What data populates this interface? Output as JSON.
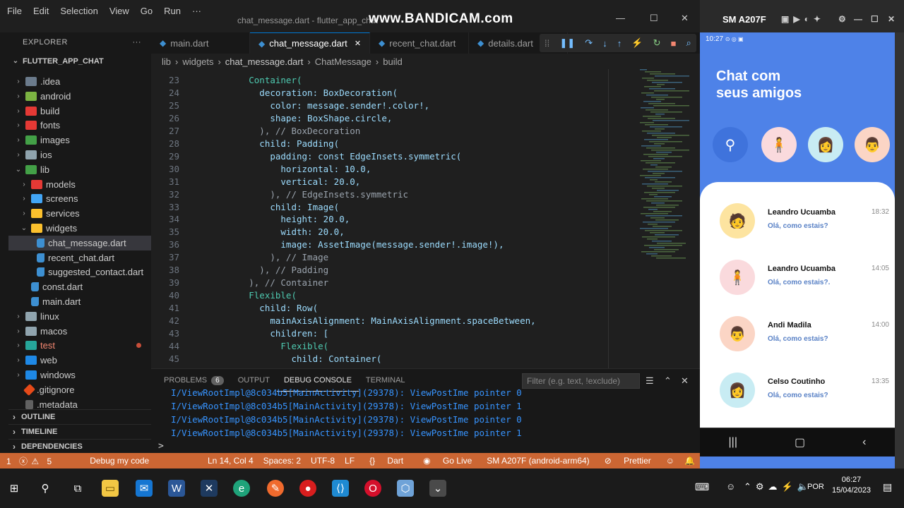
{
  "titlebar": {
    "menus": [
      "File",
      "Edit",
      "Selection",
      "View",
      "Go",
      "Run",
      "···"
    ],
    "title": "chat_message.dart - flutter_app_chat",
    "watermark": "www.BANDICAM.com"
  },
  "explorer": {
    "header": "EXPLORER",
    "more": "···",
    "project": "FLUTTER_APP_CHAT",
    "items": [
      {
        "label": ".idea",
        "indent": 1,
        "folder": true
      },
      {
        "label": "android",
        "indent": 1,
        "folder": true
      },
      {
        "label": "build",
        "indent": 1,
        "folder": true
      },
      {
        "label": "fonts",
        "indent": 1,
        "folder": true
      },
      {
        "label": "images",
        "indent": 1,
        "folder": true
      },
      {
        "label": "ios",
        "indent": 1,
        "folder": true
      },
      {
        "label": "lib",
        "indent": 1,
        "folder": true,
        "open": true
      },
      {
        "label": "models",
        "indent": 2,
        "folder": true
      },
      {
        "label": "screens",
        "indent": 2,
        "folder": true
      },
      {
        "label": "services",
        "indent": 2,
        "folder": true
      },
      {
        "label": "widgets",
        "indent": 2,
        "folder": true,
        "open": true
      },
      {
        "label": "chat_message.dart",
        "indent": 3,
        "folder": false,
        "selected": true
      },
      {
        "label": "recent_chat.dart",
        "indent": 3,
        "folder": false
      },
      {
        "label": "suggested_contact.dart",
        "indent": 3,
        "folder": false
      },
      {
        "label": "const.dart",
        "indent": 2,
        "folder": false
      },
      {
        "label": "main.dart",
        "indent": 2,
        "folder": false
      },
      {
        "label": "linux",
        "indent": 1,
        "folder": true
      },
      {
        "label": "macos",
        "indent": 1,
        "folder": true
      },
      {
        "label": "test",
        "indent": 1,
        "folder": true,
        "error": true
      },
      {
        "label": "web",
        "indent": 1,
        "folder": true
      },
      {
        "label": "windows",
        "indent": 1,
        "folder": true
      },
      {
        "label": ".gitignore",
        "indent": 1,
        "folder": false
      },
      {
        "label": ".metadata",
        "indent": 1,
        "folder": false
      }
    ],
    "sections": [
      "OUTLINE",
      "TIMELINE",
      "DEPENDENCIES"
    ]
  },
  "tabs": [
    "main.dart",
    "chat_message.dart",
    "recent_chat.dart",
    "details.dart"
  ],
  "active_tab": 1,
  "breadcrumb": [
    "lib",
    "widgets",
    "chat_message.dart",
    "ChatMessage",
    "build"
  ],
  "code": [
    {
      "n": "23",
      "t": "          Container("
    },
    {
      "n": "24",
      "t": "            decoration: BoxDecoration("
    },
    {
      "n": "25",
      "t": "              color: message.sender!.color!,"
    },
    {
      "n": "26",
      "t": "              shape: BoxShape.circle,"
    },
    {
      "n": "27",
      "t": "            ), // BoxDecoration"
    },
    {
      "n": "28",
      "t": "            child: Padding("
    },
    {
      "n": "29",
      "t": "              padding: const EdgeInsets.symmetric("
    },
    {
      "n": "30",
      "t": "                horizontal: 10.0,"
    },
    {
      "n": "31",
      "t": "                vertical: 20.0,"
    },
    {
      "n": "32",
      "t": "              ), // EdgeInsets.symmetric"
    },
    {
      "n": "33",
      "t": "              child: Image("
    },
    {
      "n": "34",
      "t": "                height: 20.0,"
    },
    {
      "n": "35",
      "t": "                width: 20.0,"
    },
    {
      "n": "36",
      "t": "                image: AssetImage(message.sender!.image!),"
    },
    {
      "n": "37",
      "t": "              ), // Image"
    },
    {
      "n": "38",
      "t": "            ), // Padding"
    },
    {
      "n": "39",
      "t": "          ), // Container"
    },
    {
      "n": "40",
      "t": "          Flexible("
    },
    {
      "n": "41",
      "t": "            child: Row("
    },
    {
      "n": "42",
      "t": "              mainAxisAlignment: MainAxisAlignment.spaceBetween,"
    },
    {
      "n": "43",
      "t": "              children: ["
    },
    {
      "n": "44",
      "t": "                Flexible("
    },
    {
      "n": "45",
      "t": "                  child: Container("
    }
  ],
  "panel": {
    "tabs": [
      "PROBLEMS",
      "OUTPUT",
      "DEBUG CONSOLE",
      "TERMINAL"
    ],
    "problems_count": "6",
    "active": 2,
    "filter_placeholder": "Filter (e.g. text, !exclude)",
    "log": [
      "I/ViewRootImpl@8c034b5[MainActivity](29378): ViewPostIme pointer 0",
      "I/ViewRootImpl@8c034b5[MainActivity](29378): ViewPostIme pointer 1",
      "I/ViewRootImpl@8c034b5[MainActivity](29378): ViewPostIme pointer 0",
      "I/ViewRootImpl@8c034b5[MainActivity](29378): ViewPostIme pointer 1"
    ],
    "prompt": ">"
  },
  "statusbar": {
    "errors": "1",
    "warnings": "5",
    "debug": "Debug my code",
    "position": "Ln 14, Col 4",
    "spaces": "Spaces: 2",
    "encoding": "UTF-8",
    "eol": "LF",
    "language": "Dart",
    "golive": "Go Live",
    "device": "SM A207F (android-arm64)",
    "prettier": "Prettier",
    "color": "#cc6633"
  },
  "phone": {
    "device_title": "SM A207F",
    "time": "10:27",
    "title_line1": "Chat com",
    "title_line2": "seus amigos",
    "accent": "#4e82e8",
    "chats": [
      {
        "name": "Leandro Ucuamba",
        "message": "Olá, como estais?",
        "time": "18:32",
        "avatar_color": "#fde4a0"
      },
      {
        "name": "Leandro Ucuamba",
        "message": "Olá, como estais?.",
        "time": "14:05",
        "avatar_color": "#fadadd"
      },
      {
        "name": "Andi Madila",
        "message": "Olá, como estais?",
        "time": "14:00",
        "avatar_color": "#fbd5c5"
      },
      {
        "name": "Celso Coutinho",
        "message": "Olá, como estais?",
        "time": "13:35",
        "avatar_color": "#c8ecf3"
      }
    ]
  },
  "taskbar": {
    "lang": "POR",
    "time": "06:27",
    "date": "15/04/2023"
  }
}
